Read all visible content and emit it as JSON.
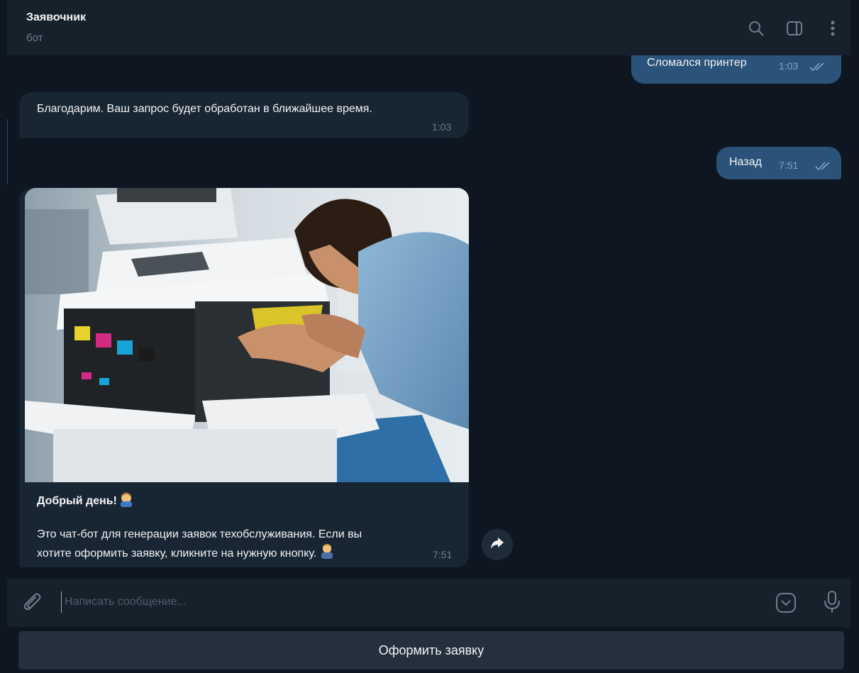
{
  "header": {
    "title": "Заявочник",
    "subtitle": "бот"
  },
  "messages": {
    "m1": {
      "text": "Сломался принтер",
      "time": "1:03"
    },
    "m2": {
      "text": "Благодарим. Ваш запрос будет обработан в ближайшее время.",
      "time": "1:03"
    },
    "m3": {
      "text": "Назад",
      "time": "7:51"
    },
    "m4": {
      "greeting": "Добрый день!",
      "line1": "Это чат-бот для генерации заявок техобслуживания. Если вы",
      "line2": "хотите оформить заявку, кликните на нужную кнопку.",
      "time": "7:51"
    }
  },
  "composer": {
    "placeholder": "Написать сообщение..."
  },
  "keyboard": {
    "button_label": "Оформить заявку"
  },
  "colors": {
    "background": "#0e1621",
    "header": "#17212b",
    "outgoing_bubble": "#2b5278",
    "incoming_bubble": "#182533",
    "accent": "#5eb5f7"
  },
  "icons": [
    "search-icon",
    "sidebar-toggle-icon",
    "more-vertical-icon",
    "double-check-icon",
    "forward-icon",
    "attach-icon",
    "emoji-icon",
    "microphone-icon"
  ]
}
